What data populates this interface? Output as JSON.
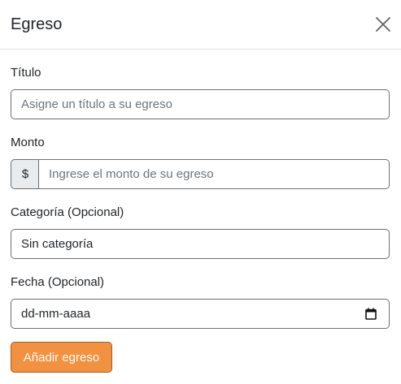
{
  "modal": {
    "title": "Egreso"
  },
  "form": {
    "titulo": {
      "label": "Título",
      "value": "",
      "placeholder": "Asigne un título a su egreso"
    },
    "monto": {
      "label": "Monto",
      "prefix": "$",
      "value": "",
      "placeholder": "Ingrese el monto de su egreso"
    },
    "categoria": {
      "label": "Categoría (Opcional)",
      "selected": "Sin categoría"
    },
    "fecha": {
      "label": "Fecha (Opcional)",
      "value": "dd-mm-aaaa"
    },
    "submit_label": "Añadir egreso"
  },
  "colors": {
    "accent": "#f2913f",
    "border": "#6c6f73",
    "prefix_bg": "#e9ecef"
  },
  "icons": {
    "close": "close-icon",
    "calendar": "calendar-icon"
  }
}
